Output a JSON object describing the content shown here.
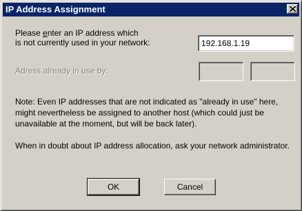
{
  "window": {
    "title": "IP Address Assignment",
    "close_icon": "close-icon"
  },
  "prompt": {
    "line1_pre": "Please ",
    "line1_accel": "e",
    "line1_post": "nter an IP address which",
    "line2": "is not currently used in your network:"
  },
  "ip_input": {
    "value": "192.168.1.19"
  },
  "in_use": {
    "label": "Adress already in use by:",
    "field1": "",
    "field2": ""
  },
  "note": {
    "text": "Note: Even IP addresses that are not indicated as \"already in use\" here, might nevertheless be assigned to another host (which could just be unavailable at the moment, but will be back later)."
  },
  "advice": {
    "text": "When in doubt about IP address allocation, ask your network administrator."
  },
  "buttons": {
    "ok": "OK",
    "cancel": "Cancel"
  }
}
